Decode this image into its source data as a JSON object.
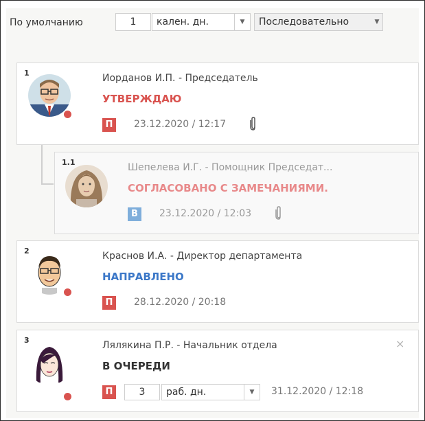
{
  "toolbar": {
    "default_label": "По умолчанию",
    "days_value": "1",
    "unit_label": "кален. дн.",
    "order_label": "Последовательно"
  },
  "colors": {
    "approved": "#d9534f",
    "remarks": "#e8898a",
    "sent": "#3c78c8",
    "queued": "#333333",
    "badge_p": "#d9534f",
    "badge_v": "#7faedb",
    "status_dot": "#d9534f"
  },
  "approvers": [
    {
      "num": "1",
      "name": "Иорданов И.П. - Председатель",
      "status": "УТВЕРЖДАЮ",
      "badge": "П",
      "date": "23.12.2020 / 12:17",
      "attachment_icon": "paperclip-icon"
    },
    {
      "num": "1.1",
      "name": "Шепелева И.Г. - Помощник Председат...",
      "status": "СОГЛАСОВАНО С ЗАМЕЧАНИЯМИ.",
      "badge": "В",
      "date": "23.12.2020 / 12:03",
      "attachment_icon": "paperclip-icon"
    },
    {
      "num": "2",
      "name": "Краснов И.А. - Директор департамента",
      "status": "НАПРАВЛЕНО",
      "badge": "П",
      "date": "28.12.2020 / 20:18"
    },
    {
      "num": "3",
      "name": "Лялякина П.Р. - Начальник отдела",
      "status": "В ОЧЕРЕДИ",
      "badge": "П",
      "days_value": "3",
      "unit_label": "раб. дн.",
      "date": "31.12.2020 / 12:18",
      "close_label": "×"
    }
  ]
}
